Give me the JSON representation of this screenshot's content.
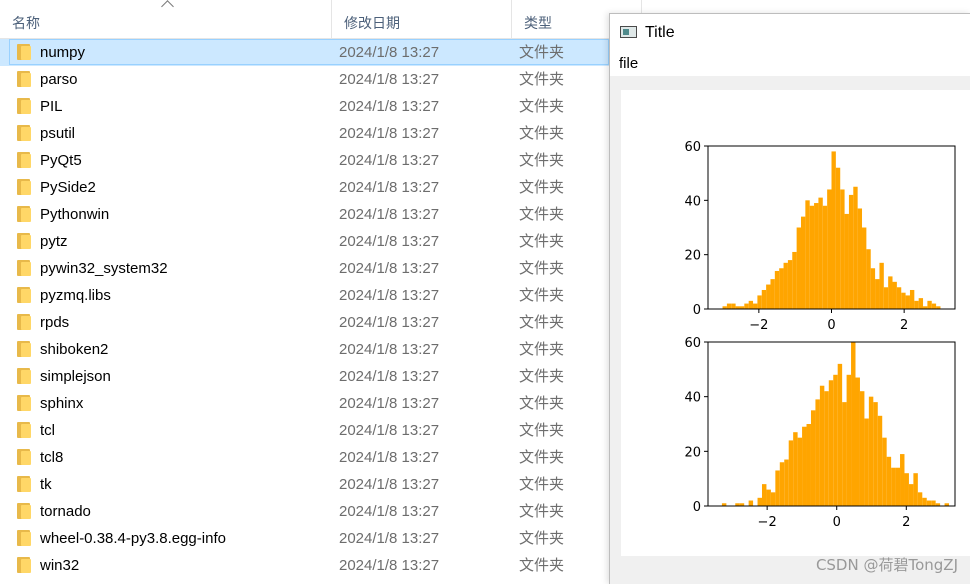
{
  "explorer": {
    "columns": {
      "name": "名称",
      "modified": "修改日期",
      "type": "类型"
    },
    "rows": [
      {
        "name": "numpy",
        "date": "2024/1/8 13:27",
        "type": "文件夹"
      },
      {
        "name": "parso",
        "date": "2024/1/8 13:27",
        "type": "文件夹"
      },
      {
        "name": "PIL",
        "date": "2024/1/8 13:27",
        "type": "文件夹"
      },
      {
        "name": "psutil",
        "date": "2024/1/8 13:27",
        "type": "文件夹"
      },
      {
        "name": "PyQt5",
        "date": "2024/1/8 13:27",
        "type": "文件夹"
      },
      {
        "name": "PySide2",
        "date": "2024/1/8 13:27",
        "type": "文件夹"
      },
      {
        "name": "Pythonwin",
        "date": "2024/1/8 13:27",
        "type": "文件夹"
      },
      {
        "name": "pytz",
        "date": "2024/1/8 13:27",
        "type": "文件夹"
      },
      {
        "name": "pywin32_system32",
        "date": "2024/1/8 13:27",
        "type": "文件夹"
      },
      {
        "name": "pyzmq.libs",
        "date": "2024/1/8 13:27",
        "type": "文件夹"
      },
      {
        "name": "rpds",
        "date": "2024/1/8 13:27",
        "type": "文件夹"
      },
      {
        "name": "shiboken2",
        "date": "2024/1/8 13:27",
        "type": "文件夹"
      },
      {
        "name": "simplejson",
        "date": "2024/1/8 13:27",
        "type": "文件夹"
      },
      {
        "name": "sphinx",
        "date": "2024/1/8 13:27",
        "type": "文件夹"
      },
      {
        "name": "tcl",
        "date": "2024/1/8 13:27",
        "type": "文件夹"
      },
      {
        "name": "tcl8",
        "date": "2024/1/8 13:27",
        "type": "文件夹"
      },
      {
        "name": "tk",
        "date": "2024/1/8 13:27",
        "type": "文件夹"
      },
      {
        "name": "tornado",
        "date": "2024/1/8 13:27",
        "type": "文件夹"
      },
      {
        "name": "wheel-0.38.4-py3.8.egg-info",
        "date": "2024/1/8 13:27",
        "type": "文件夹"
      },
      {
        "name": "win32",
        "date": "2024/1/8 13:27",
        "type": "文件夹"
      }
    ],
    "selected_row": "numpy",
    "selection_color": "#cce8ff",
    "folder_color": "#ffd767"
  },
  "plot_window": {
    "title": "Title",
    "menu": {
      "file": "file"
    }
  },
  "watermark": "CSDN @荷碧TongZJ",
  "chart_data": [
    {
      "type": "bar",
      "subtype": "histogram",
      "color": "#ffa500",
      "xlim": [
        -3.4,
        3.4
      ],
      "ylim": [
        0,
        60
      ],
      "xticks": [
        -2,
        0,
        2
      ],
      "yticks": [
        0,
        20,
        40,
        60
      ],
      "bin_start": -3.0,
      "bin_width": 0.12,
      "values": [
        1,
        2,
        2,
        1,
        1,
        2,
        3,
        2,
        5,
        7,
        9,
        11,
        14,
        15,
        17,
        18,
        21,
        30,
        34,
        40,
        38,
        39,
        41,
        38,
        44,
        58,
        52,
        44,
        35,
        42,
        45,
        37,
        30,
        22,
        15,
        11,
        17,
        8,
        12,
        10,
        8,
        6,
        5,
        7,
        3,
        4,
        1,
        3,
        2,
        1
      ]
    },
    {
      "type": "bar",
      "subtype": "histogram",
      "color": "#ffa500",
      "xlim": [
        -3.7,
        3.4
      ],
      "ylim": [
        0,
        60
      ],
      "xticks": [
        -2,
        0,
        2
      ],
      "yticks": [
        0,
        20,
        40,
        60
      ],
      "bin_start": -3.3,
      "bin_width": 0.128,
      "values": [
        1,
        0,
        0,
        1,
        1,
        0,
        2,
        0,
        3,
        8,
        6,
        5,
        13,
        16,
        17,
        24,
        27,
        25,
        29,
        30,
        35,
        39,
        44,
        42,
        46,
        48,
        52,
        38,
        48,
        60,
        47,
        42,
        32,
        40,
        38,
        33,
        25,
        18,
        14,
        14,
        19,
        12,
        8,
        12,
        5,
        3,
        2,
        2,
        1,
        0,
        1
      ]
    }
  ]
}
